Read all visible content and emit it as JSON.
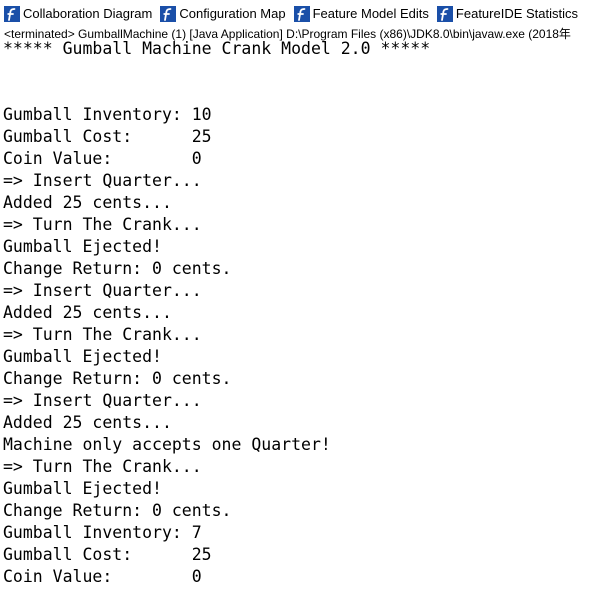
{
  "tabs": [
    {
      "label": "Collaboration Diagram",
      "icon": "featureide-f-icon"
    },
    {
      "label": "Configuration Map",
      "icon": "featureide-f-icon"
    },
    {
      "label": "Feature Model Edits",
      "icon": "featureide-f-icon"
    },
    {
      "label": "FeatureIDE Statistics",
      "icon": "featureide-f-icon"
    }
  ],
  "console": {
    "header": "<terminated> GumballMachine (1) [Java Application] D:\\Program Files (x86)\\JDK8.0\\bin\\javaw.exe (2018年",
    "lines": [
      "***** Gumball Machine Crank Model 2.0 *****",
      "",
      "",
      "Gumball Inventory: 10",
      "Gumball Cost:      25",
      "Coin Value:        0",
      "=> Insert Quarter...",
      "Added 25 cents...",
      "=> Turn The Crank...",
      "Gumball Ejected!",
      "Change Return: 0 cents.",
      "=> Insert Quarter...",
      "Added 25 cents...",
      "=> Turn The Crank...",
      "Gumball Ejected!",
      "Change Return: 0 cents.",
      "=> Insert Quarter...",
      "Added 25 cents...",
      "Machine only accepts one Quarter!",
      "=> Turn The Crank...",
      "Gumball Ejected!",
      "Change Return: 0 cents.",
      "Gumball Inventory: 7",
      "Gumball Cost:      25",
      "Coin Value:        0"
    ]
  },
  "colors": {
    "icon_blue": "#1a4fa8",
    "text": "#000000",
    "background": "#ffffff"
  }
}
